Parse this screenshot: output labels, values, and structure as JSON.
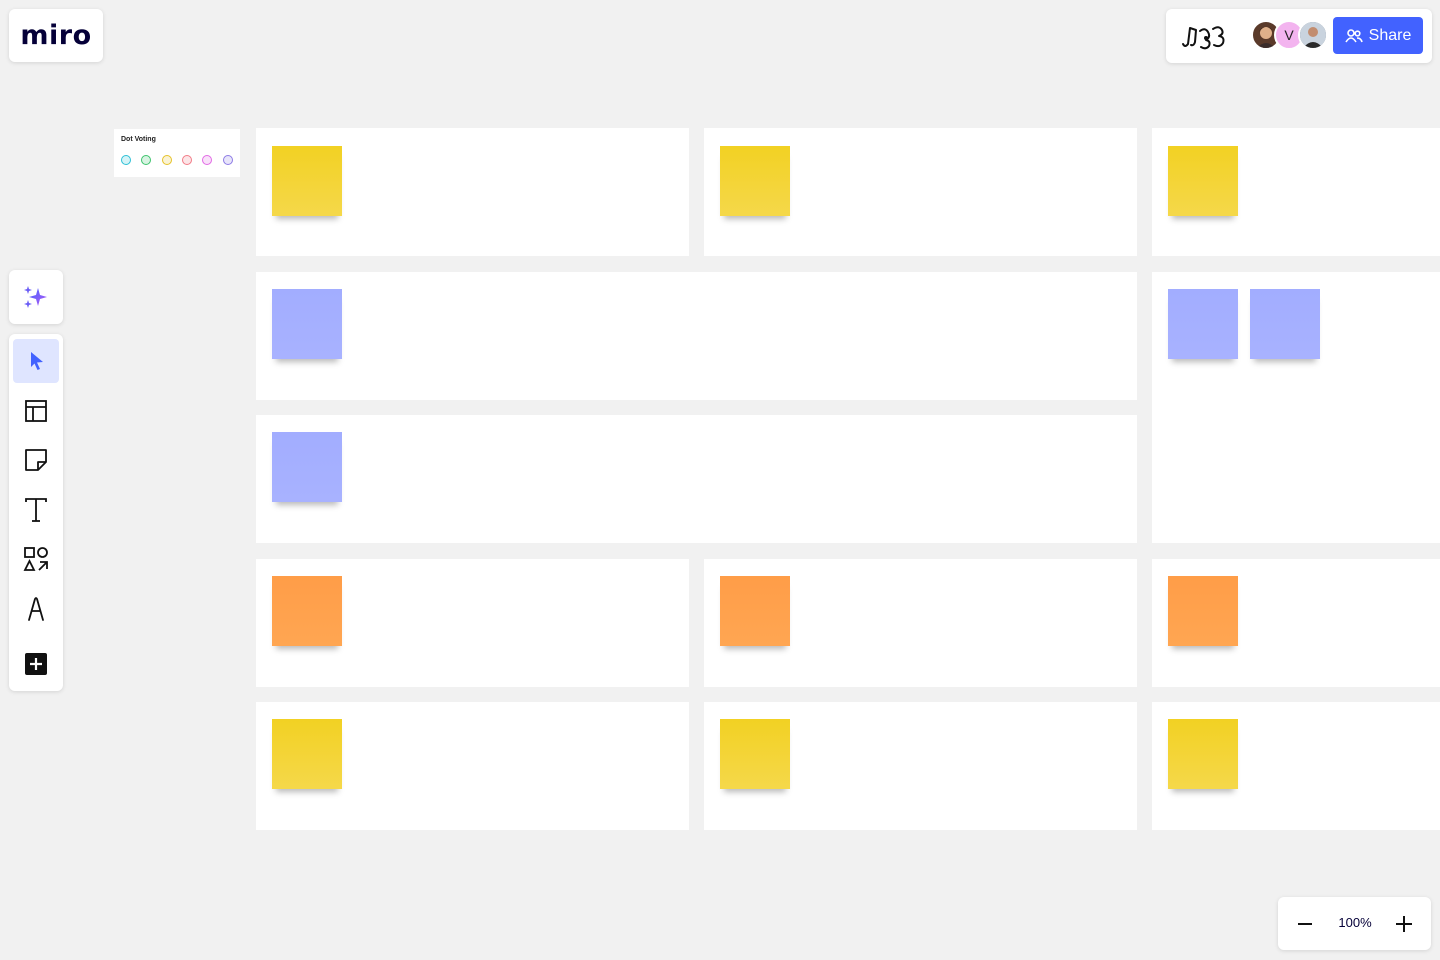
{
  "app": {
    "logo_text": "miro"
  },
  "header": {
    "avatars": [
      {
        "name": "avatar-photo-1",
        "initial": ""
      },
      {
        "name": "avatar-initial-v",
        "initial": "V"
      },
      {
        "name": "avatar-photo-3",
        "initial": ""
      }
    ],
    "share_label": "Share"
  },
  "dot_voting": {
    "title": "Dot Voting",
    "dots": [
      "#2ec1d6",
      "#3ec46d",
      "#e6c229",
      "#f27b87",
      "#e26ae5",
      "#8d7be5"
    ]
  },
  "zoom": {
    "level": "100%"
  },
  "colors": {
    "accent": "#4262ff",
    "sticky_yellow": "#f2d123",
    "sticky_purple": "#a2adff",
    "sticky_orange": "#ff9d48"
  },
  "toolbar": {
    "tools": [
      "select-tool",
      "templates-tool",
      "sticky-note-tool",
      "text-tool",
      "shapes-tool",
      "pen-tool",
      "more-apps-tool"
    ]
  }
}
